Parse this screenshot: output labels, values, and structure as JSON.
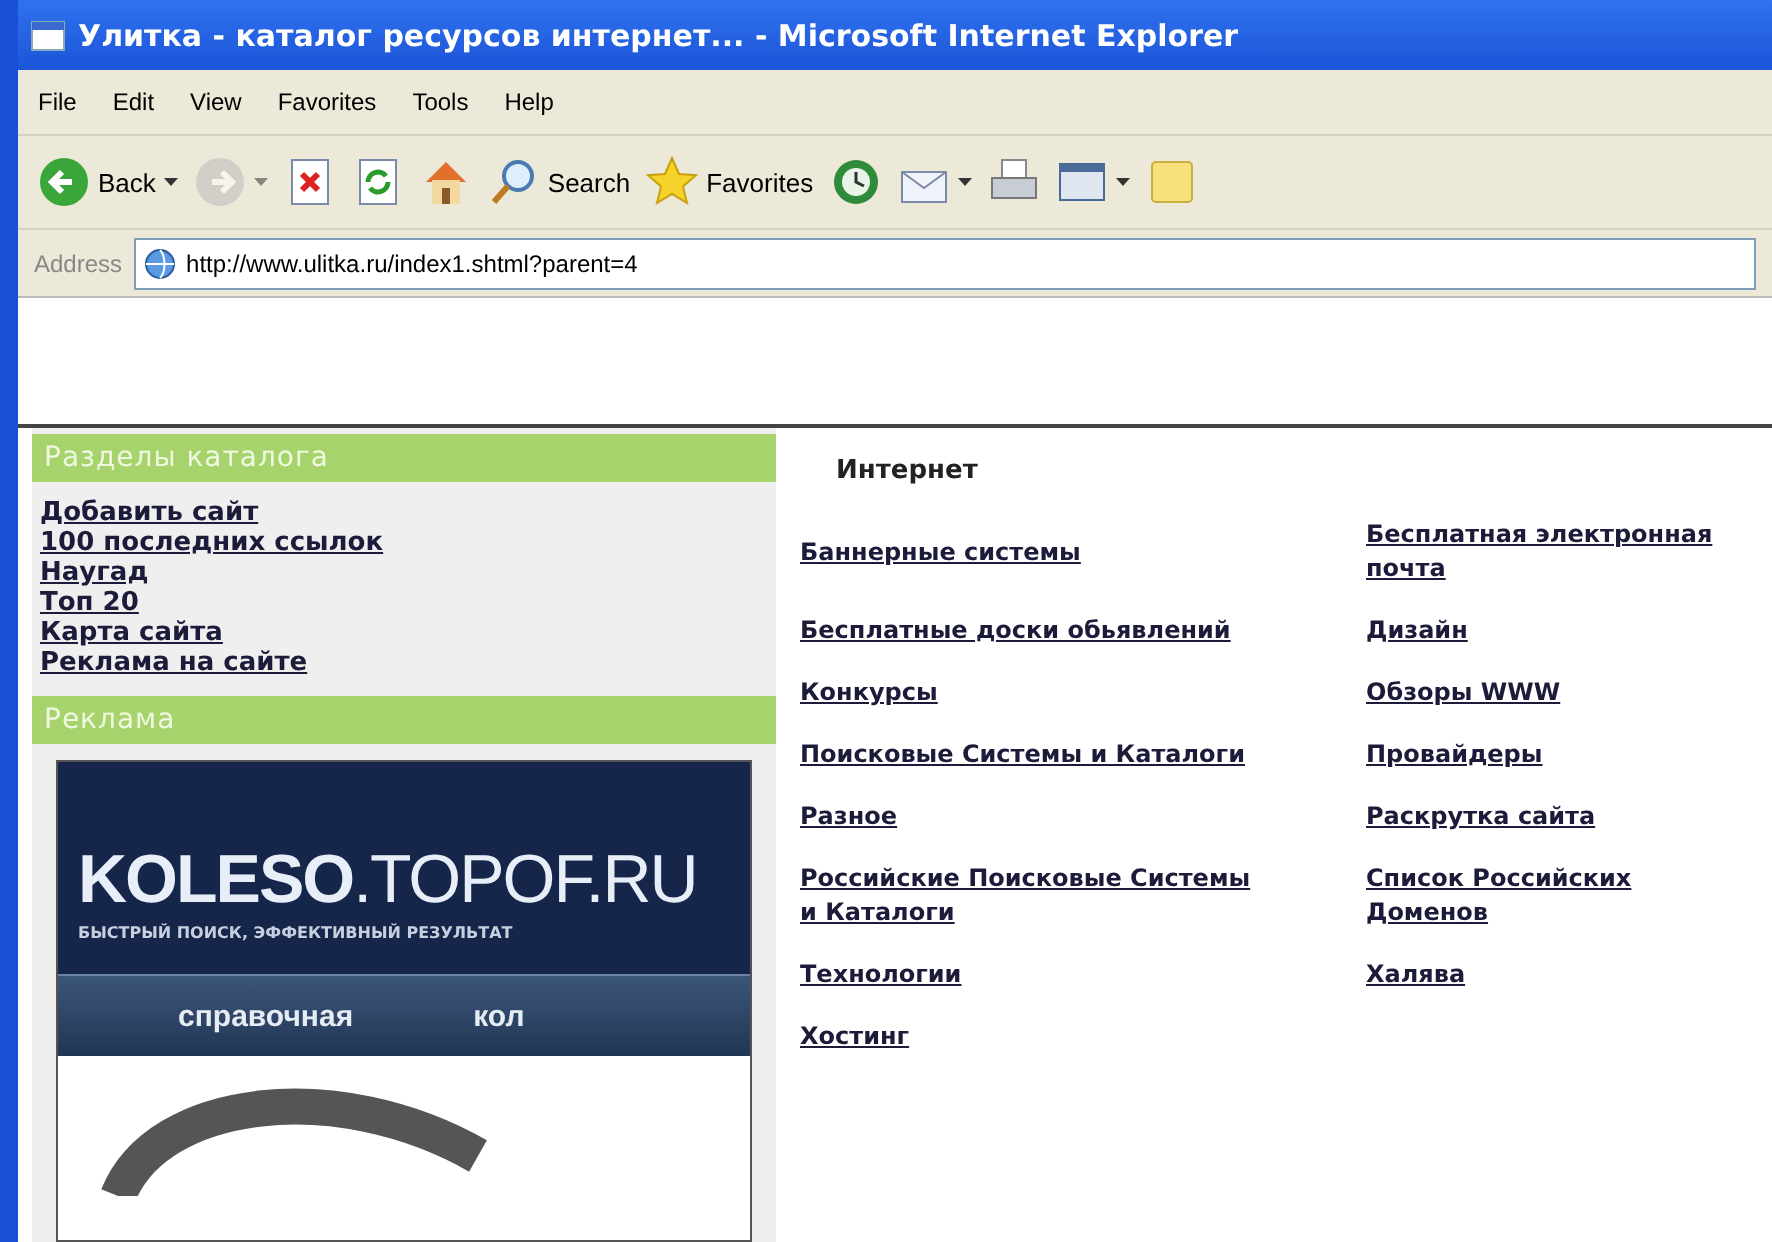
{
  "window": {
    "title": "Улитка - каталог ресурсов интернет... - Microsoft Internet Explorer"
  },
  "menu": [
    "File",
    "Edit",
    "View",
    "Favorites",
    "Tools",
    "Help"
  ],
  "toolbar": [
    {
      "kind": "back",
      "label": "Back",
      "dropdown": true,
      "disabled": false
    },
    {
      "kind": "forward",
      "dropdown": true,
      "disabled": true
    },
    {
      "kind": "stop",
      "dropdown": false,
      "disabled": false
    },
    {
      "kind": "refresh",
      "dropdown": false,
      "disabled": false
    },
    {
      "kind": "home",
      "dropdown": false,
      "disabled": false
    },
    {
      "kind": "search",
      "label": "Search",
      "dropdown": false,
      "disabled": false
    },
    {
      "kind": "favorites",
      "label": "Favorites",
      "dropdown": false,
      "disabled": false
    },
    {
      "kind": "history",
      "dropdown": false,
      "disabled": false
    },
    {
      "kind": "mail",
      "dropdown": true,
      "disabled": false
    },
    {
      "kind": "print",
      "dropdown": false,
      "disabled": false
    },
    {
      "kind": "edit",
      "dropdown": true,
      "disabled": false
    },
    {
      "kind": "note",
      "dropdown": false,
      "disabled": false
    }
  ],
  "address": {
    "label": "Address",
    "value": "http://www.ulitka.ru/index1.shtml?parent=4"
  },
  "sidebar": {
    "sections": [
      {
        "title": "Разделы каталога",
        "links": [
          "Добавить сайт",
          "100 последних ссылок",
          "Наугад",
          "Топ 20",
          "Карта сайта",
          "Реклама на сайте"
        ]
      },
      {
        "title": "Реклама",
        "ad": {
          "logo_bold": "KOLESO",
          "logo_rest": ".TOPOF.RU",
          "tagline": "БЫСТРЫЙ ПОИСК, ЭФФЕКТИВНЫЙ РЕЗУЛЬТАТ",
          "tabs": [
            "справочная",
            "кол"
          ]
        }
      }
    ]
  },
  "content": {
    "heading": "Интернет",
    "left": [
      "Баннерные системы",
      "Бесплатные доски обьявлений",
      "Конкурсы",
      "Поисковые Системы и Каталоги",
      "Разное",
      "Российские Поисковые Системы и Каталоги",
      "Технологии",
      "Хостинг"
    ],
    "right": [
      "Бесплатная электронная почта",
      "Дизайн",
      "Обзоры WWW",
      "Провайдеры",
      "Раскрутка сайта",
      "Список Российских Доменов",
      "Халява"
    ]
  }
}
